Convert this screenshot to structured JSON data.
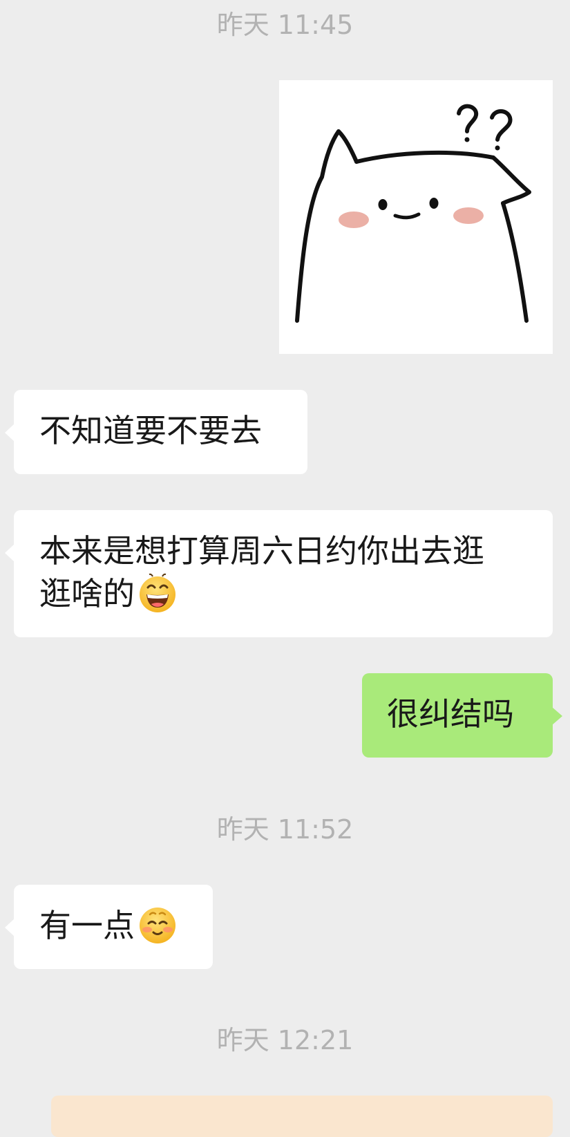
{
  "chat": {
    "timestamps": [
      "昨天 11:45",
      "昨天 11:52",
      "昨天 12:21"
    ],
    "messages": [
      {
        "side": "incoming",
        "text": "不知道要不要去"
      },
      {
        "side": "incoming",
        "text_line1": "本来是想打算周六日约你出去逛",
        "text_line2": "逛啥的",
        "emoji": "grinning-face-emoji"
      },
      {
        "side": "outgoing",
        "text": "很纠结吗"
      },
      {
        "side": "incoming",
        "text": "有一点",
        "emoji": "blushing-face-emoji"
      }
    ]
  },
  "colors": {
    "background": "#ededed",
    "incoming_bubble": "#ffffff",
    "outgoing_bubble": "#a9ea7a",
    "timestamp": "#b2b2b2",
    "message_text": "#191919",
    "card_bubble": "#fae6cf"
  },
  "icons": {
    "sticker": "confused-cat-sticker-icon",
    "emoji_grin": "grinning-face-emoji",
    "emoji_blush": "blushing-face-emoji"
  }
}
